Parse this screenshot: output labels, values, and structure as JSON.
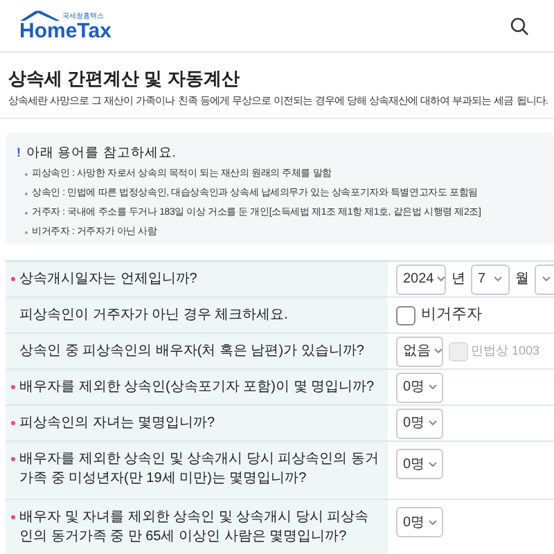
{
  "header": {
    "logo": {
      "caption": "국세청홈택스",
      "name": "HomeTax"
    }
  },
  "title": "상속세 간편계산 및 자동계산",
  "description": "상속세란 사망으로 그 재산이 가족이나 친족 등에게 무상으로 이전되는 경우에 당해 상속재산에 대하여 부과되는 세금 됩니다.",
  "notice": {
    "mark": "!",
    "heading": "아래 용어를 참고하세요.",
    "items": [
      "피상속인 : 사망한 자로서 상속의 목적이 되는 재산의 원래의 주체를 말함",
      "상속인 : 민법에 따른 법정상속인, 대습상속인과 상속세 납세의무가 있는 상속포기자와 특별연고자도 포함됨",
      "거주자 : 국내에 주소를 두거나 183일 이상 거소를 둔 개인[소득세법 제1조 제1항 제1호, 같은법 시행령 제2조]",
      "비거주자 : 거주자가 아닌 사람"
    ]
  },
  "rows": [
    {
      "kind": "date",
      "required": true,
      "label": "상속개시일자는 언제입니까?",
      "year": "2024",
      "year_unit": "년",
      "month": "7",
      "month_unit": "월"
    },
    {
      "kind": "checkbox",
      "required": false,
      "label": "피상속인이 거주자가 아닌 경우 체크하세요.",
      "checked": false,
      "option": "비거주자"
    },
    {
      "kind": "select_check",
      "required": false,
      "label": "상속인 중 피상속인의 배우자(처 혹은 남편)가 있습니까?",
      "value": "없음",
      "checked": false,
      "disabled": true,
      "option": "민법상 1003"
    },
    {
      "kind": "select",
      "required": true,
      "label": "배우자를 제외한 상속인(상속포기자 포함)이 몇 명입니까?",
      "value": "0명"
    },
    {
      "kind": "select",
      "required": true,
      "label": "피상속인의 자녀는 몇명입니까?",
      "value": "0명"
    },
    {
      "kind": "select",
      "required": true,
      "label": "배우자를 제외한 상속인 및 상속개시 당시 피상속인의 동거가족 중 미성년자(만 19세 미만)는 몇명입니까?",
      "value": "0명"
    },
    {
      "kind": "select",
      "required": true,
      "label": "배우자 및 자녀를 제외한 상속인 및 상속개시 당시 피상속인의 동거가족 중 만 65세 이상인 사람은 몇명입니까?",
      "value": "0명"
    }
  ]
}
